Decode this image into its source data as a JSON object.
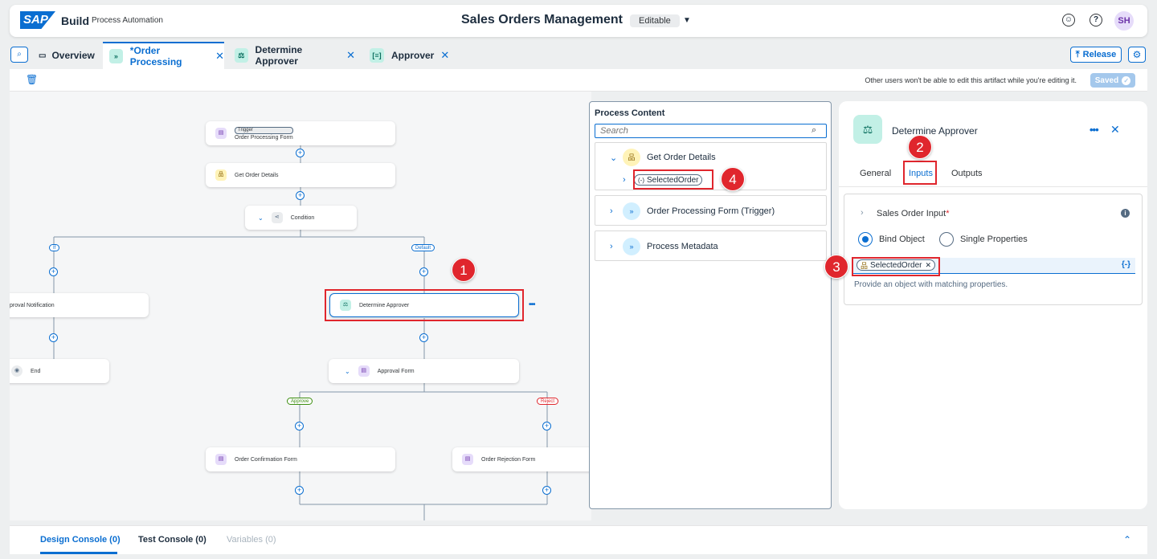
{
  "shell": {
    "logo": "SAP",
    "product": "Build",
    "product_sub": "Process Automation",
    "title": "Sales Orders Management",
    "mode": "Editable",
    "avatar": "SH"
  },
  "tabs": [
    {
      "label": "Overview"
    },
    {
      "label": "*Order Processing"
    },
    {
      "label": "Determine Approver"
    },
    {
      "label": "Approver"
    }
  ],
  "release_label": "Release",
  "toolbar": {
    "lock_message": "Other users won't be able to edit this artifact while you're editing it.",
    "saved_label": "Saved"
  },
  "canvas": {
    "trigger_tag": "Trigger",
    "nodes": {
      "order_form": "Order Processing Form",
      "get_order": "Get Order Details",
      "condition": "Condition",
      "approval_notification": "proval Notification",
      "determine_approver": "Determine Approver",
      "end": "End",
      "approval_form": "Approval Form",
      "confirmation": "Order Confirmation Form",
      "rejection": "Order Rejection Form"
    },
    "branches": {
      "if": "If",
      "default": "Default",
      "approve": "Approve",
      "reject": "Reject"
    }
  },
  "callouts": [
    "1",
    "2",
    "3",
    "4"
  ],
  "content_panel": {
    "title": "Process Content",
    "search_placeholder": "Search",
    "groups": {
      "get_order": "Get Order Details",
      "selected_order": "SelectedOrder",
      "order_form_trigger": "Order Processing Form (Trigger)",
      "metadata": "Process Metadata"
    }
  },
  "properties": {
    "title": "Determine Approver",
    "tabs": [
      "General",
      "Inputs",
      "Outputs"
    ],
    "input_label": "Sales Order Input",
    "required_mark": "*",
    "radio_bind": "Bind Object",
    "radio_single": "Single Properties",
    "bound_value": "SelectedOrder",
    "hint": "Provide an object with matching properties."
  },
  "console": {
    "tabs": [
      "Design Console (0)",
      "Test Console (0)",
      "Variables (0)"
    ]
  },
  "colors": {
    "accent": "#0a6ed1",
    "callout": "#e0262d",
    "approve": "#3c8d0f",
    "reject": "#e0262d"
  }
}
